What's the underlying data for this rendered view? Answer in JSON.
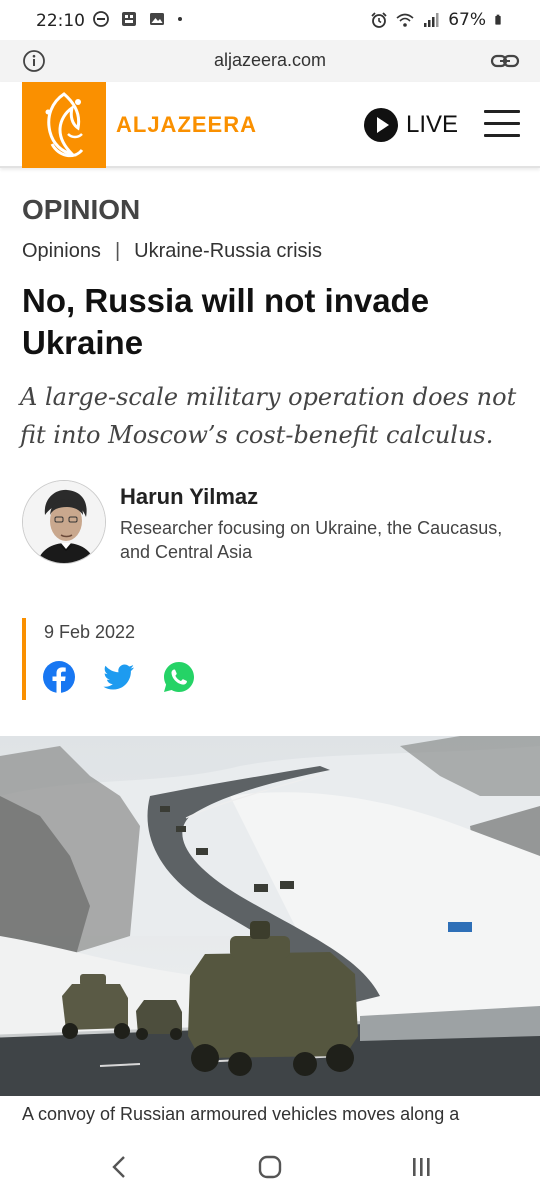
{
  "status_bar": {
    "time": "22:10",
    "battery": "67%",
    "left_icons": [
      "do-not-disturb-icon",
      "gallery-app-icon",
      "image-icon",
      "dot-icon"
    ],
    "right_icons": [
      "alarm-icon",
      "wifi-icon",
      "signal-icon",
      "battery-icon"
    ]
  },
  "browser": {
    "domain": "aljazeera.com",
    "info_icon": "info-icon",
    "link_icon": "link-icon"
  },
  "header": {
    "logo_text": "ALJAZEERA",
    "live_label": "LIVE",
    "menu_icon": "hamburger-menu-icon",
    "brand_color": "#fa9000"
  },
  "article": {
    "section": "OPINION",
    "breadcrumbs": [
      "Opinions",
      "Ukraine-Russia crisis"
    ],
    "breadcrumb_separator": "|",
    "headline": "No, Russia will not invade Ukraine",
    "subheadline": "A large-scale military operation does not fit into Moscow’s cost-benefit calculus.",
    "author": {
      "name": "Harun Yilmaz",
      "bio": "Researcher focusing on Ukraine, the Caucasus, and Central Asia"
    },
    "date": "9 Feb 2022",
    "share": [
      "facebook-icon",
      "twitter-icon",
      "whatsapp-icon"
    ],
    "caption": "A convoy of Russian armoured vehicles moves along a"
  },
  "nav": {
    "buttons": [
      "back-icon",
      "home-icon",
      "recent-apps-icon"
    ]
  }
}
